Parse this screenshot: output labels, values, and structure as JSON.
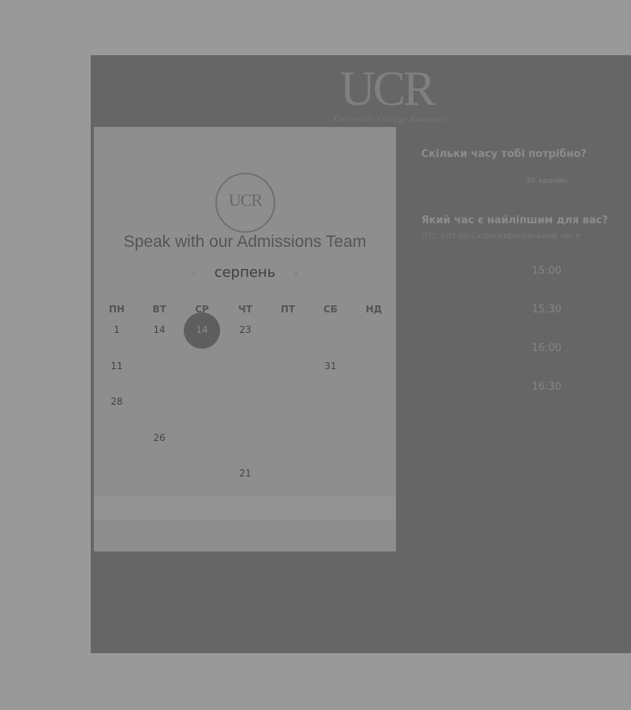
{
  "brand": {
    "logo_text": "UCR",
    "logo_subtitle": "University College Roosevelt"
  },
  "card": {
    "logo_text": "UCR",
    "title": "Speak with our Admissions Team",
    "month": "серпень",
    "prev_icon": "‹",
    "next_icon": "›",
    "weekdays": [
      "ПН",
      "ВТ",
      "СР",
      "ЧТ",
      "ПТ",
      "СБ",
      "НД"
    ],
    "weeks": [
      [
        {
          "d": "1",
          "a": true
        },
        {
          "d": "14",
          "a": true
        },
        {
          "d": "14",
          "a": true,
          "sel": true
        },
        {
          "d": "23",
          "a": true
        },
        {
          "d": "",
          "a": false
        },
        {
          "d": "",
          "a": false
        },
        {
          "d": "",
          "a": false
        }
      ],
      [
        {
          "d": "11",
          "a": true
        },
        {
          "d": "",
          "a": false
        },
        {
          "d": "",
          "a": false
        },
        {
          "d": "",
          "a": false
        },
        {
          "d": "",
          "a": false
        },
        {
          "d": "31",
          "a": true
        },
        {
          "d": "",
          "a": false
        }
      ],
      [
        {
          "d": "28",
          "a": true
        },
        {
          "d": "",
          "a": false
        },
        {
          "d": "",
          "a": false
        },
        {
          "d": "",
          "a": false
        },
        {
          "d": "",
          "a": false
        },
        {
          "d": "",
          "a": false
        },
        {
          "d": "",
          "a": false
        }
      ],
      [
        {
          "d": "",
          "a": false
        },
        {
          "d": "26",
          "a": true
        },
        {
          "d": "",
          "a": false
        },
        {
          "d": "",
          "a": false
        },
        {
          "d": "",
          "a": false
        },
        {
          "d": "",
          "a": false
        },
        {
          "d": "",
          "a": false
        }
      ],
      [
        {
          "d": "",
          "a": false
        },
        {
          "d": "",
          "a": false
        },
        {
          "d": "",
          "a": false
        },
        {
          "d": "21",
          "a": true
        },
        {
          "d": "",
          "a": false
        },
        {
          "d": "",
          "a": false
        },
        {
          "d": "",
          "a": false
        }
      ]
    ]
  },
  "scheduler": {
    "duration_question": "Скільки часу тобі потрібно?",
    "duration_value": "30 хвилин",
    "time_question": "Який час є найліпшим для вас?",
    "timezone": "UTC +03:00 Східноєвропейський час ▾",
    "slots": [
      "15:00",
      "15:30",
      "16:00",
      "16:30"
    ]
  }
}
